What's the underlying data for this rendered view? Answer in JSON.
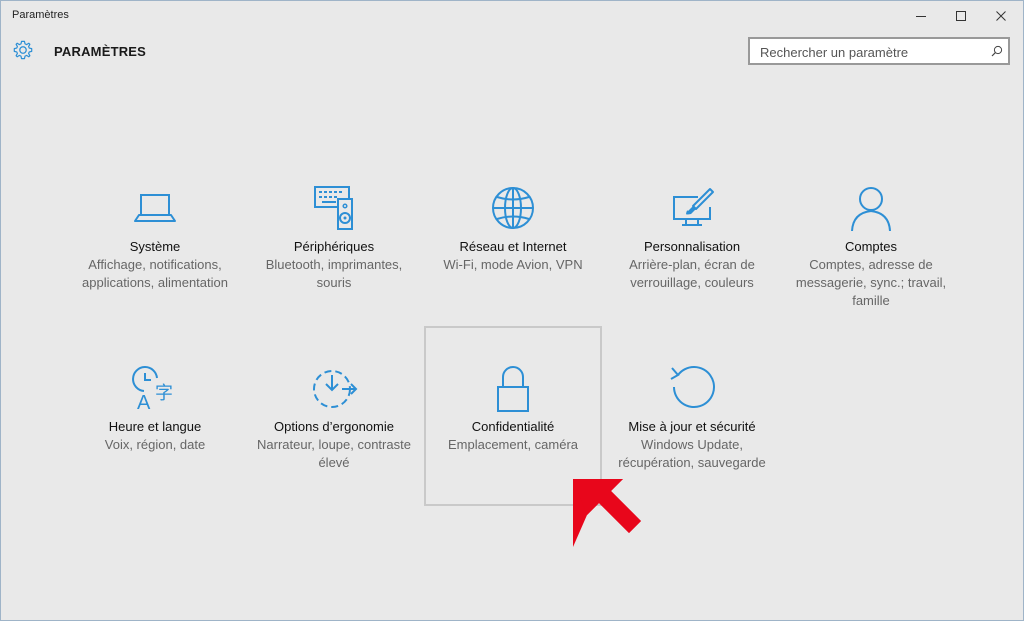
{
  "window": {
    "title": "Paramètres"
  },
  "header": {
    "title": "PARAMÈTRES",
    "search_placeholder": "Rechercher un paramètre"
  },
  "colors": {
    "accent": "#2d8fd5",
    "arrow": "#e8061b"
  },
  "tiles": [
    {
      "label": "Système",
      "desc": "Affichage, notifications, applications, alimentation",
      "icon": "laptop-icon"
    },
    {
      "label": "Périphériques",
      "desc": "Bluetooth, imprimantes, souris",
      "icon": "devices-icon"
    },
    {
      "label": "Réseau et Internet",
      "desc": "Wi-Fi, mode Avion, VPN",
      "icon": "globe-icon"
    },
    {
      "label": "Personnalisation",
      "desc": "Arrière-plan, écran de verrouillage, couleurs",
      "icon": "paintbrush-icon"
    },
    {
      "label": "Comptes",
      "desc": "Comptes, adresse de messagerie, sync.; travail, famille",
      "icon": "person-icon"
    },
    {
      "label": "Heure et langue",
      "desc": "Voix, région, date",
      "icon": "time-language-icon"
    },
    {
      "label": "Options d’ergonomie",
      "desc": "Narrateur, loupe, contraste élevé",
      "icon": "ease-of-access-icon"
    },
    {
      "label": "Confidentialité",
      "desc": "Emplacement, caméra",
      "icon": "lock-icon"
    },
    {
      "label": "Mise à jour et sécurité",
      "desc": "Windows Update, récupération, sauvegarde",
      "icon": "refresh-icon"
    }
  ]
}
